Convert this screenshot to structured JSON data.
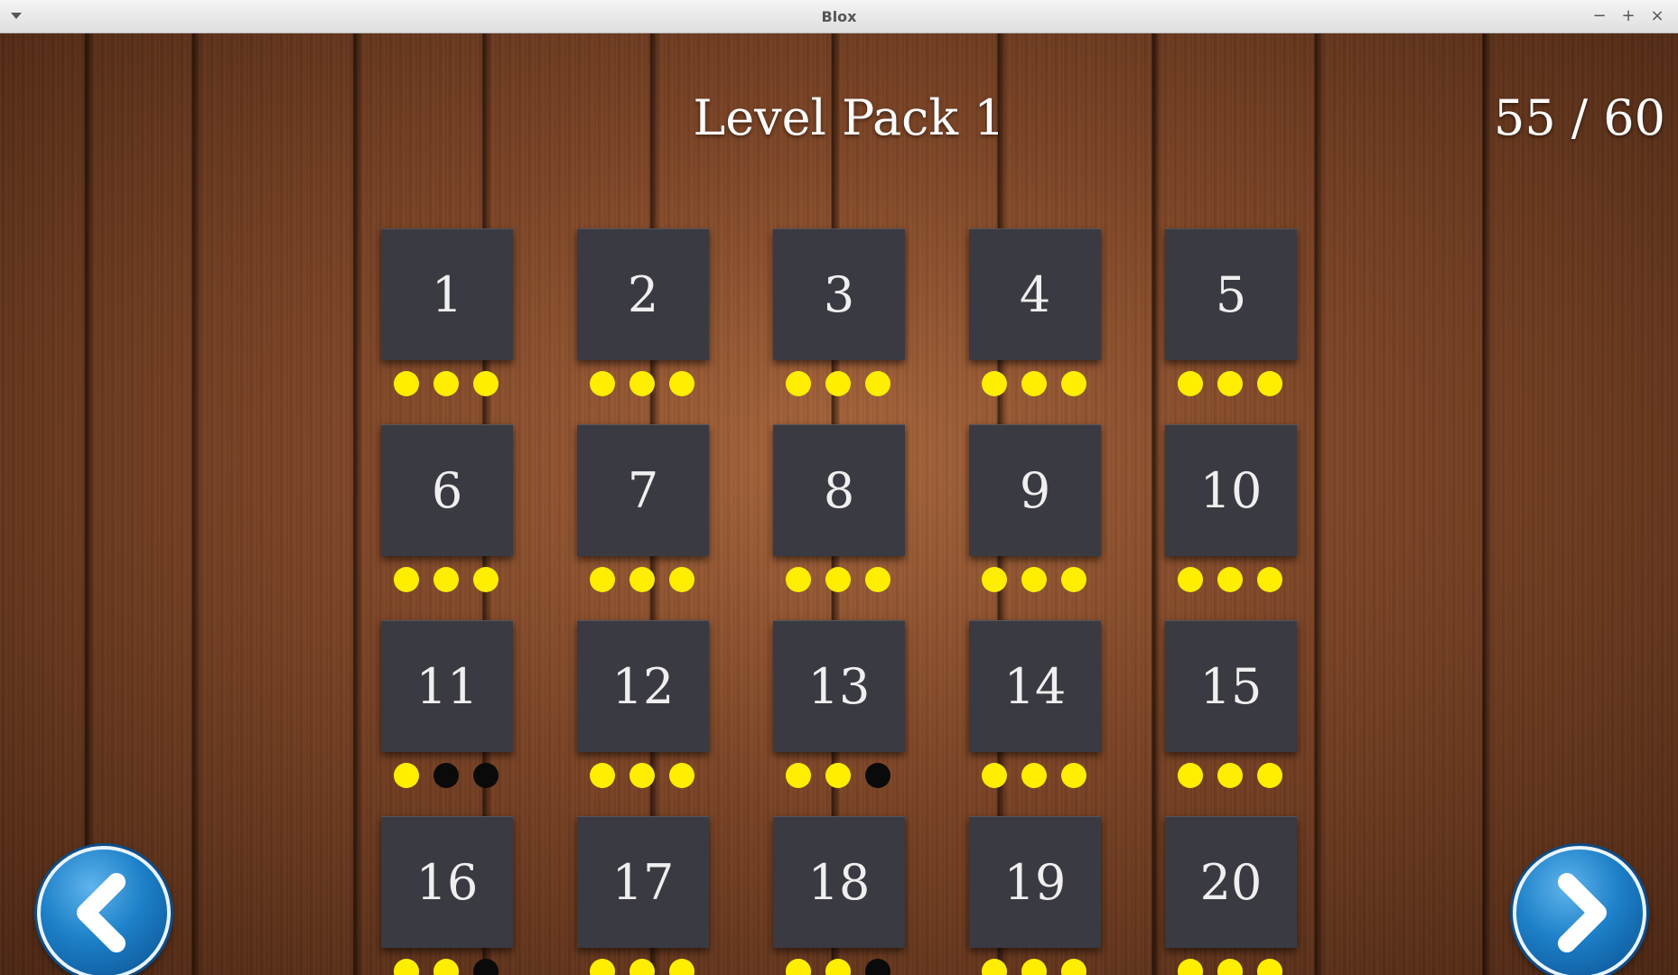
{
  "window": {
    "title": "Blox",
    "controls": {
      "minimize": "−",
      "maximize": "+",
      "close": "×"
    }
  },
  "header": {
    "pack_title": "Level Pack 1",
    "score": "55 / 60"
  },
  "levels": [
    {
      "label": "1",
      "stars": [
        true,
        true,
        true
      ]
    },
    {
      "label": "2",
      "stars": [
        true,
        true,
        true
      ]
    },
    {
      "label": "3",
      "stars": [
        true,
        true,
        true
      ]
    },
    {
      "label": "4",
      "stars": [
        true,
        true,
        true
      ]
    },
    {
      "label": "5",
      "stars": [
        true,
        true,
        true
      ]
    },
    {
      "label": "6",
      "stars": [
        true,
        true,
        true
      ]
    },
    {
      "label": "7",
      "stars": [
        true,
        true,
        true
      ]
    },
    {
      "label": "8",
      "stars": [
        true,
        true,
        true
      ]
    },
    {
      "label": "9",
      "stars": [
        true,
        true,
        true
      ]
    },
    {
      "label": "10",
      "stars": [
        true,
        true,
        true
      ]
    },
    {
      "label": "11",
      "stars": [
        true,
        false,
        false
      ]
    },
    {
      "label": "12",
      "stars": [
        true,
        true,
        true
      ]
    },
    {
      "label": "13",
      "stars": [
        true,
        true,
        false
      ]
    },
    {
      "label": "14",
      "stars": [
        true,
        true,
        true
      ]
    },
    {
      "label": "15",
      "stars": [
        true,
        true,
        true
      ]
    },
    {
      "label": "16",
      "stars": [
        true,
        true,
        false
      ]
    },
    {
      "label": "17",
      "stars": [
        true,
        true,
        true
      ]
    },
    {
      "label": "18",
      "stars": [
        true,
        true,
        false
      ]
    },
    {
      "label": "19",
      "stars": [
        true,
        true,
        true
      ]
    },
    {
      "label": "20",
      "stars": [
        true,
        true,
        true
      ]
    }
  ],
  "navigation": {
    "prev_icon": "chevron-left-icon",
    "next_icon": "chevron-right-icon"
  },
  "colors": {
    "tile": "#3a3a42",
    "star_earned": "#ffee00",
    "star_missing": "#0a0a0a",
    "nav_button": "#1d80c8"
  }
}
